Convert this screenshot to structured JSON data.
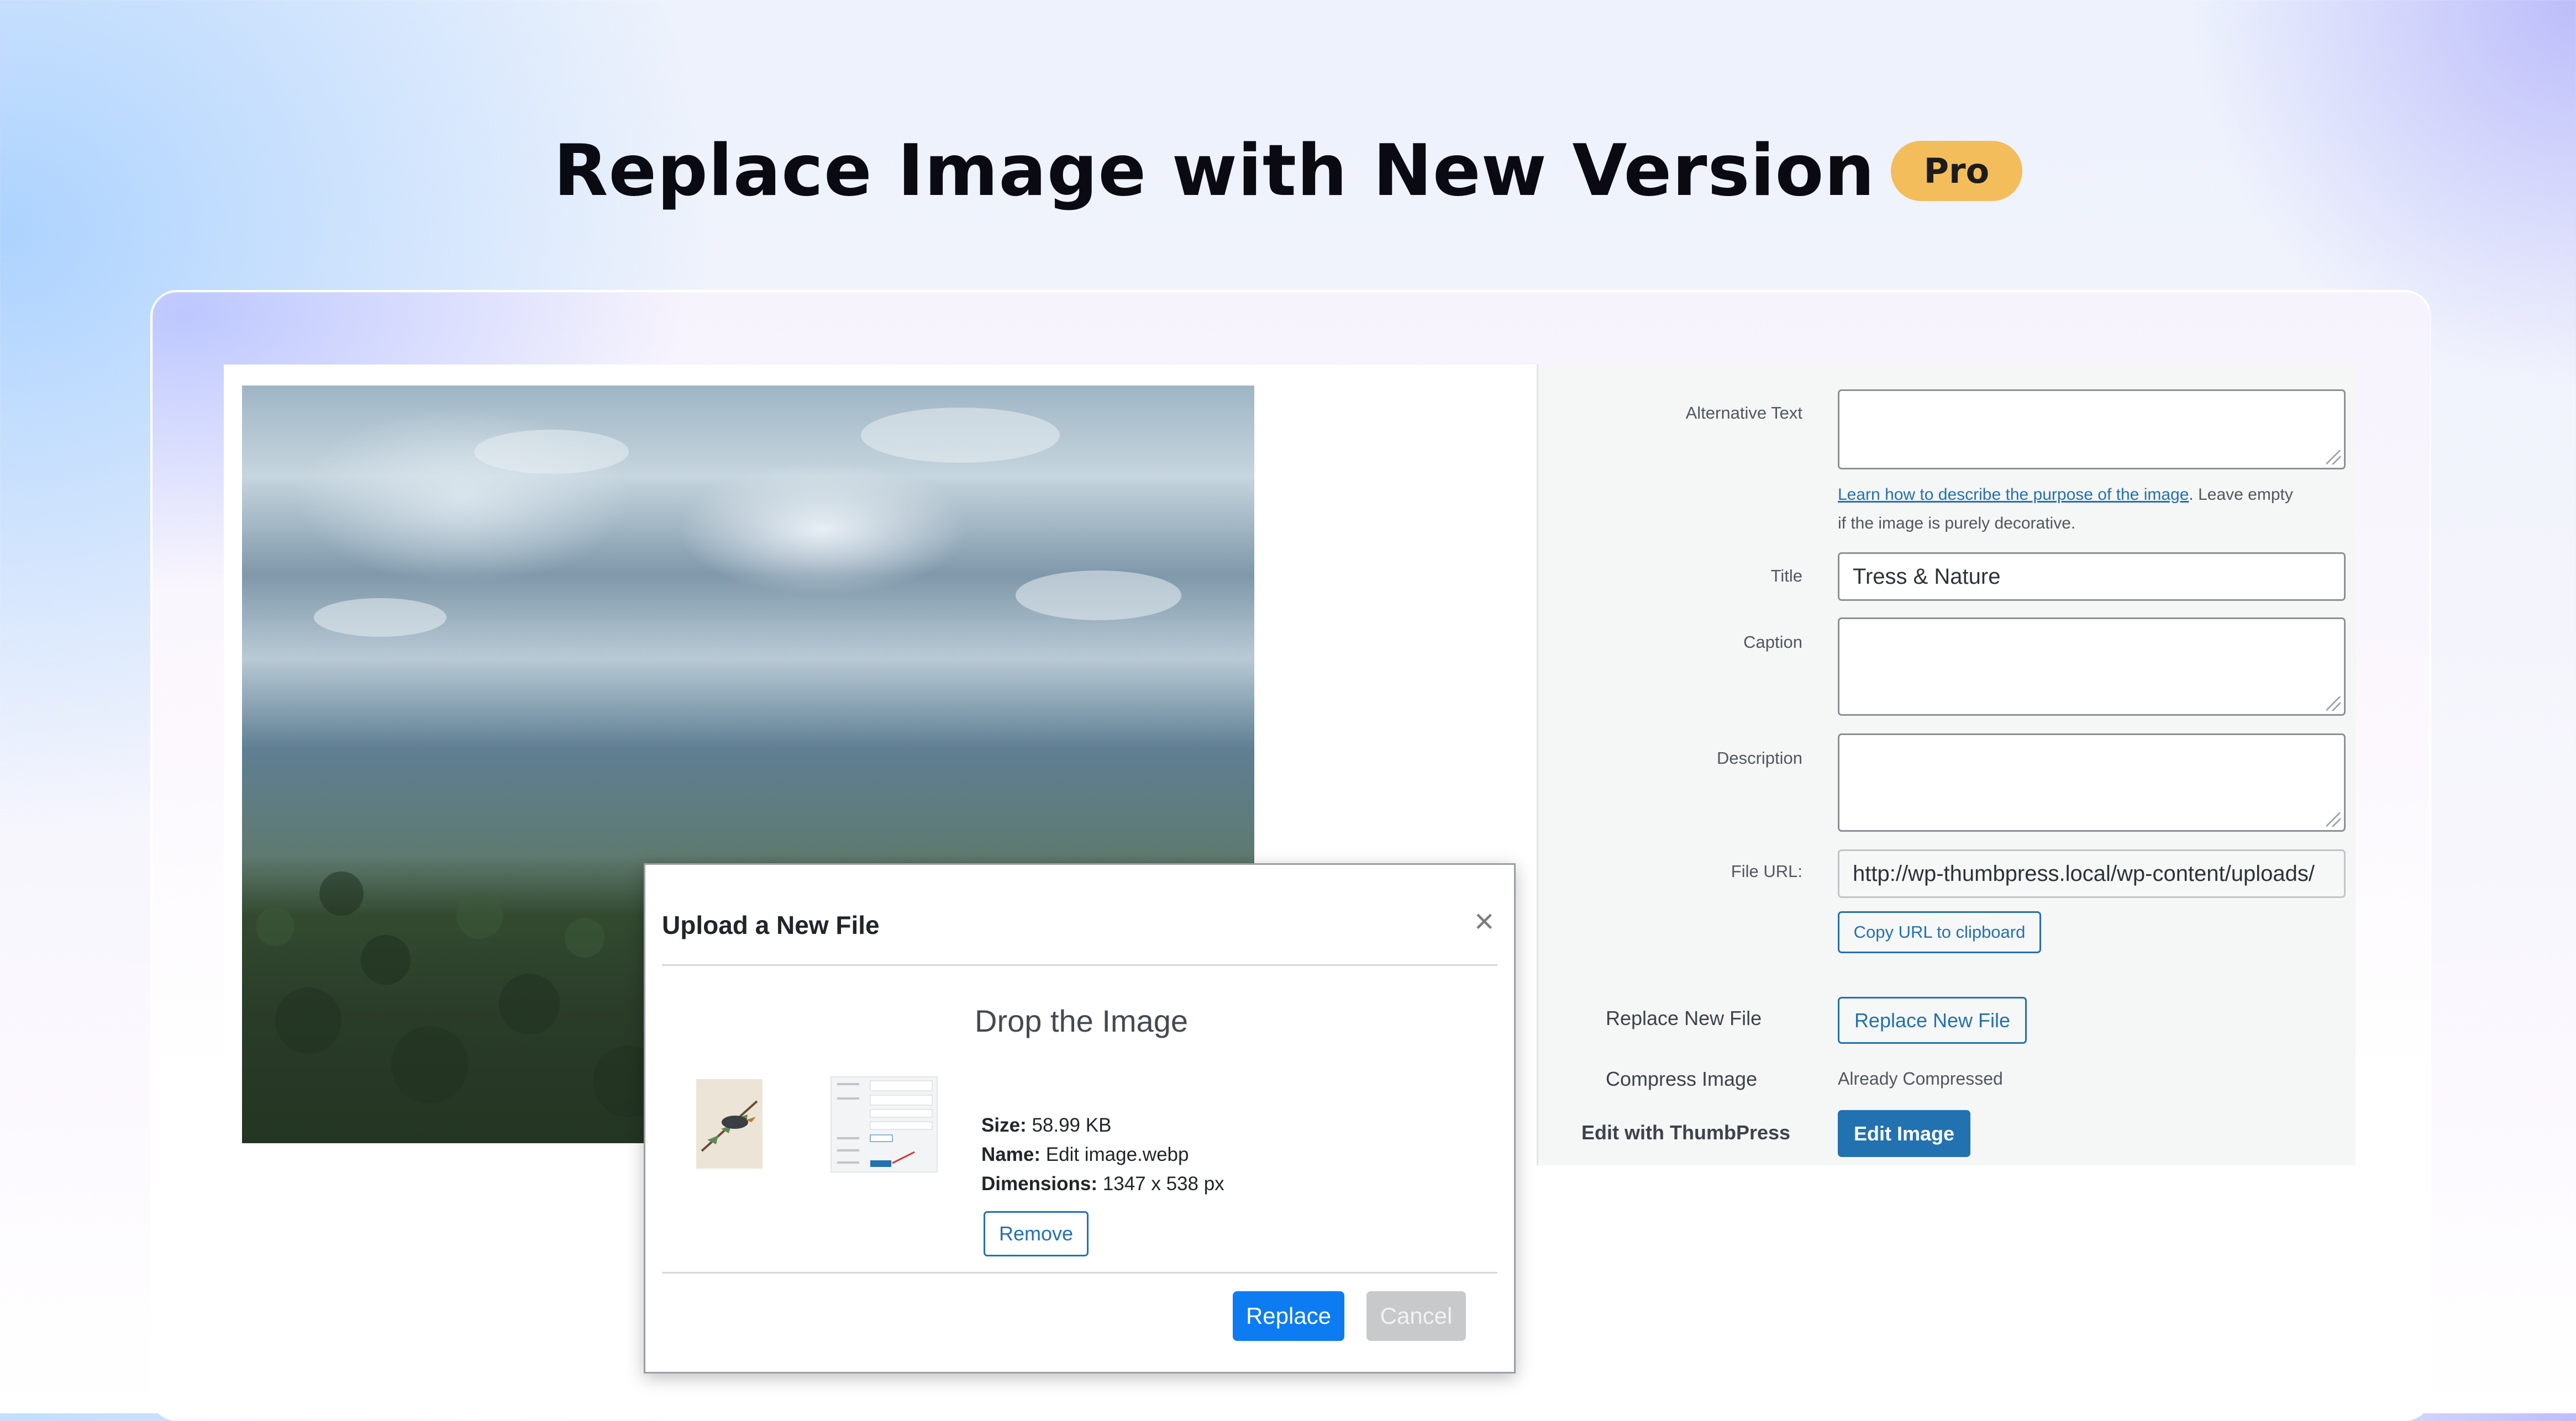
{
  "header": {
    "title": "Replace Image with New Version",
    "badge": "Pro"
  },
  "attachment_panel": {
    "alt_text": {
      "label": "Alternative Text",
      "value": "",
      "help_link": "Learn how to describe the purpose of the image",
      "help_text_1": ". Leave empty",
      "help_text_2": "if the image is purely decorative."
    },
    "title": {
      "label": "Title",
      "value": "Tress & Nature"
    },
    "caption": {
      "label": "Caption",
      "value": ""
    },
    "description": {
      "label": "Description",
      "value": ""
    },
    "file_url": {
      "label": "File URL:",
      "value": "http://wp-thumbpress.local/wp-content/uploads/"
    },
    "copy_url_button": "Copy URL to clipboard",
    "replace_file": {
      "label": "Replace New File",
      "button": "Replace New File"
    },
    "compress": {
      "label": "Compress Image",
      "status": "Already Compressed"
    },
    "edit": {
      "label": "Edit with ThumbPress",
      "button": "Edit Image"
    }
  },
  "modal": {
    "title": "Upload a New File",
    "close_icon": "×",
    "drop_text": "Drop the Image",
    "size_label": "Size:",
    "size_value": "58.99 KB",
    "name_label": "Name:",
    "name_value": "Edit image.webp",
    "dimensions_label": "Dimensions:",
    "dimensions_value": "1347 x 538 px",
    "remove_button": "Remove",
    "replace_button": "Replace",
    "cancel_button": "Cancel"
  },
  "colors": {
    "badge": "#f4bd5c",
    "wp_blue": "#2271b1",
    "modal_primary": "#0d7cf2",
    "modal_disabled": "#c8c9cb"
  }
}
